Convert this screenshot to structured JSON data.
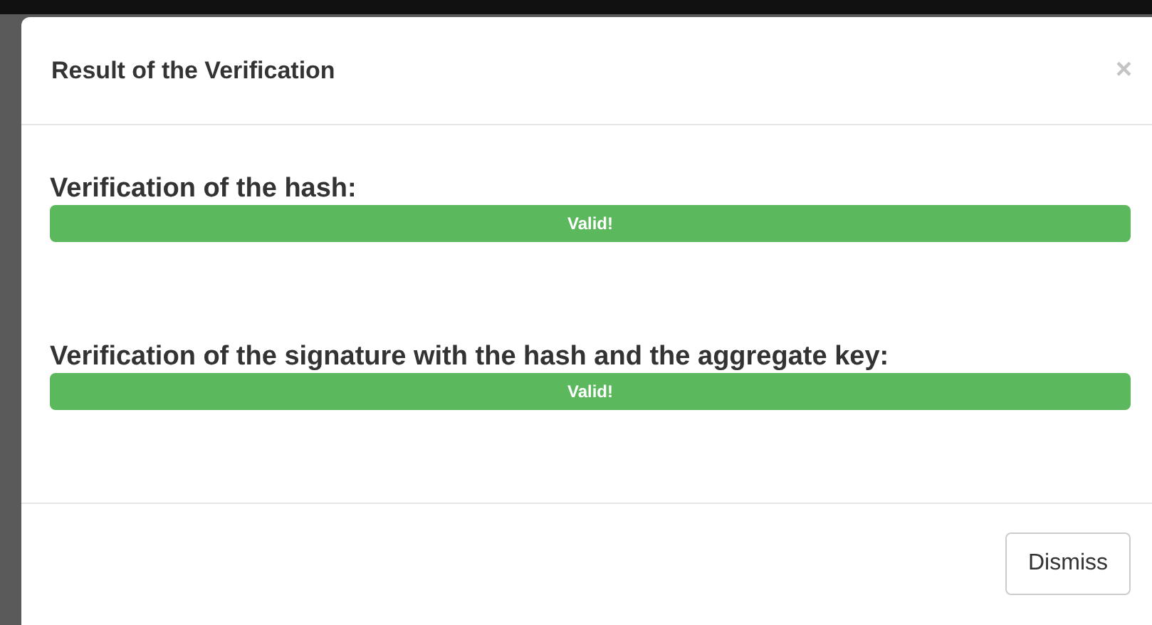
{
  "dialog": {
    "title": "Result of the Verification",
    "close": "×",
    "checks": [
      {
        "label": "Verification of the hash:",
        "status": "Valid!",
        "level": 1
      },
      {
        "label": "Verification of the signature with the hash and the aggregate key:",
        "status": "Valid!",
        "level": 1
      }
    ],
    "buttons": [
      "Dismiss"
    ]
  }
}
